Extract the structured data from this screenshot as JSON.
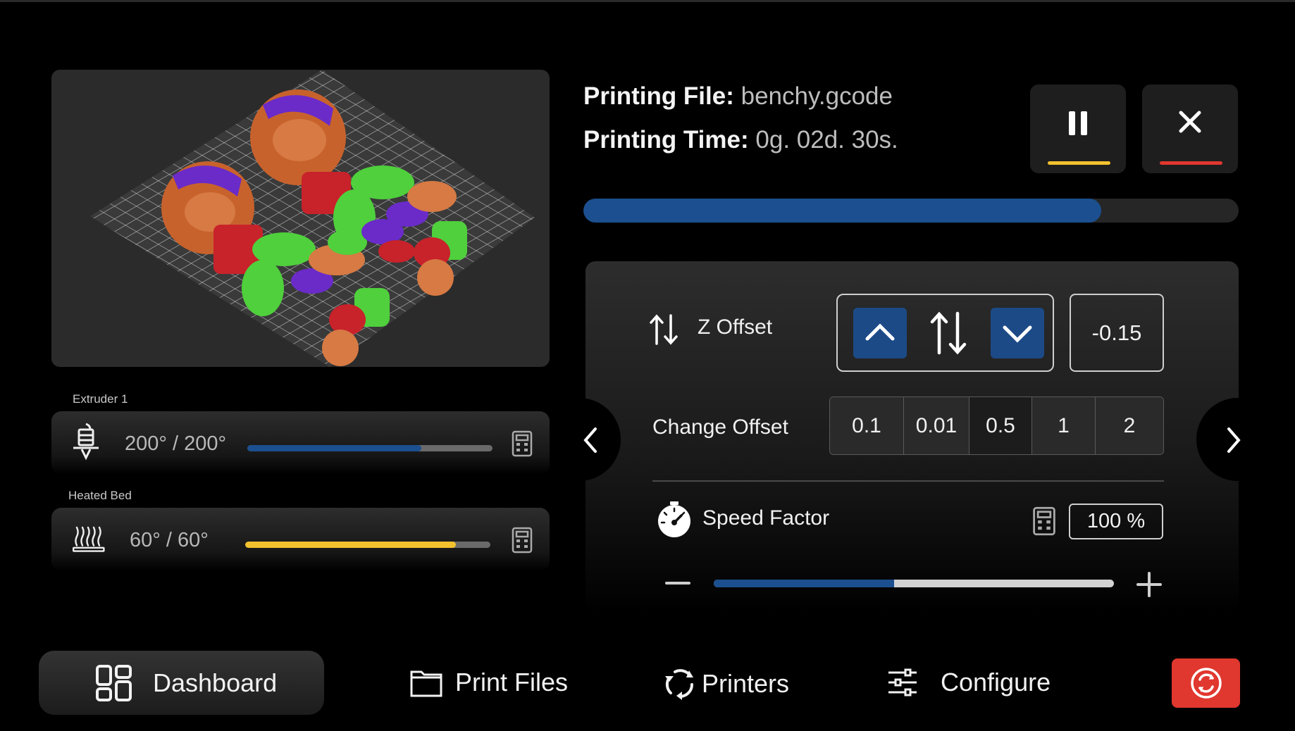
{
  "print": {
    "file_label": "Printing File:",
    "file_name": "benchy.gcode",
    "time_label": "Printing Time:",
    "time_value": "0g. 02d. 30s.",
    "progress_pct": 79
  },
  "controls": {
    "pause_icon": "pause-icon",
    "cancel_icon": "close-icon",
    "pause_color": "#f2c12e",
    "cancel_color": "#e0372f"
  },
  "extruder": {
    "label": "Extruder 1",
    "value": "200° / 200°",
    "fill_pct": 71,
    "color": "#1b4f8f",
    "icon": "nozzle-icon"
  },
  "bed": {
    "label": "Heated Bed",
    "value": "60° / 60°",
    "fill_pct": 86,
    "color": "#f2c12e",
    "icon": "heated-bed-icon"
  },
  "z_offset": {
    "label": "Z Offset",
    "value": "-0.15",
    "icon": "z-offset-arrows-icon"
  },
  "change_offset": {
    "label": "Change Offset",
    "options": [
      "0.1",
      "0.01",
      "0.5",
      "1",
      "2"
    ],
    "selected": "0.5"
  },
  "speed_factor": {
    "label": "Speed Factor",
    "value": "100 %",
    "slider_pct": 45,
    "icon": "speedometer-icon"
  },
  "nav": {
    "dashboard": "Dashboard",
    "print_files": "Print Files",
    "printers": "Printers",
    "configure": "Configure",
    "active": "dashboard"
  },
  "theme": {
    "accent_blue": "#1b4f8f",
    "accent_red": "#e0372f"
  }
}
